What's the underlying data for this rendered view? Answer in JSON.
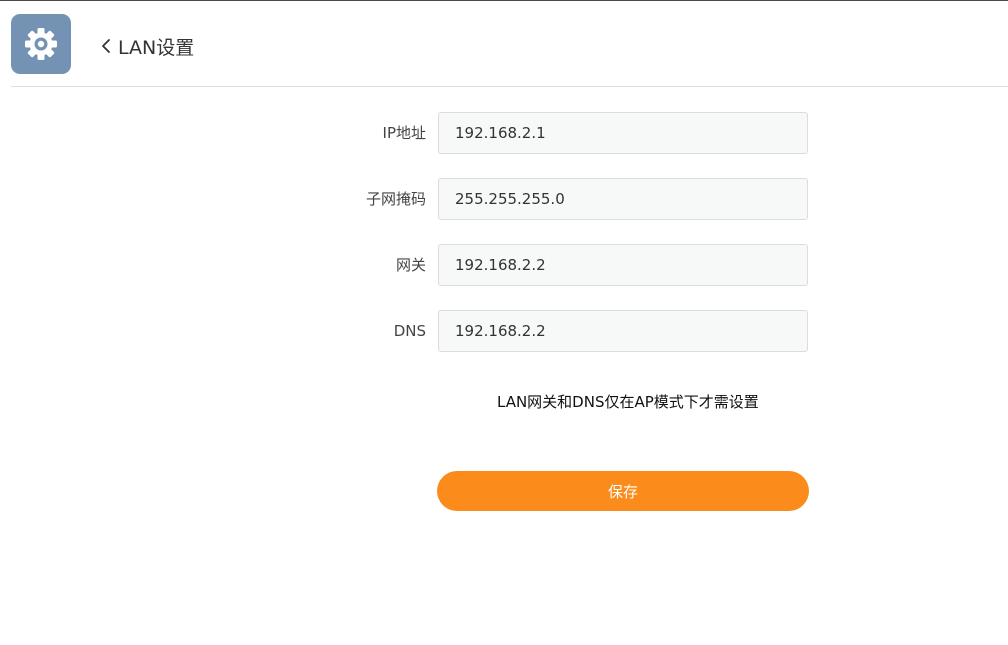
{
  "header": {
    "icon": "gear-icon",
    "back_icon": "chevron-left-icon",
    "title": "LAN设置"
  },
  "form": {
    "ip": {
      "label": "IP地址",
      "value": "192.168.2.1"
    },
    "subnet": {
      "label": "子网掩码",
      "value": "255.255.255.0"
    },
    "gateway": {
      "label": "网关",
      "value": "192.168.2.2"
    },
    "dns": {
      "label": "DNS",
      "value": "192.168.2.2"
    }
  },
  "note": "LAN网关和DNS仅在AP模式下才需设置",
  "save_label": "保存",
  "colors": {
    "accent": "#fb8c1b",
    "app_icon_bg": "#7493b4",
    "input_bg": "#f7f8f8",
    "input_border": "#dcdcdc"
  }
}
